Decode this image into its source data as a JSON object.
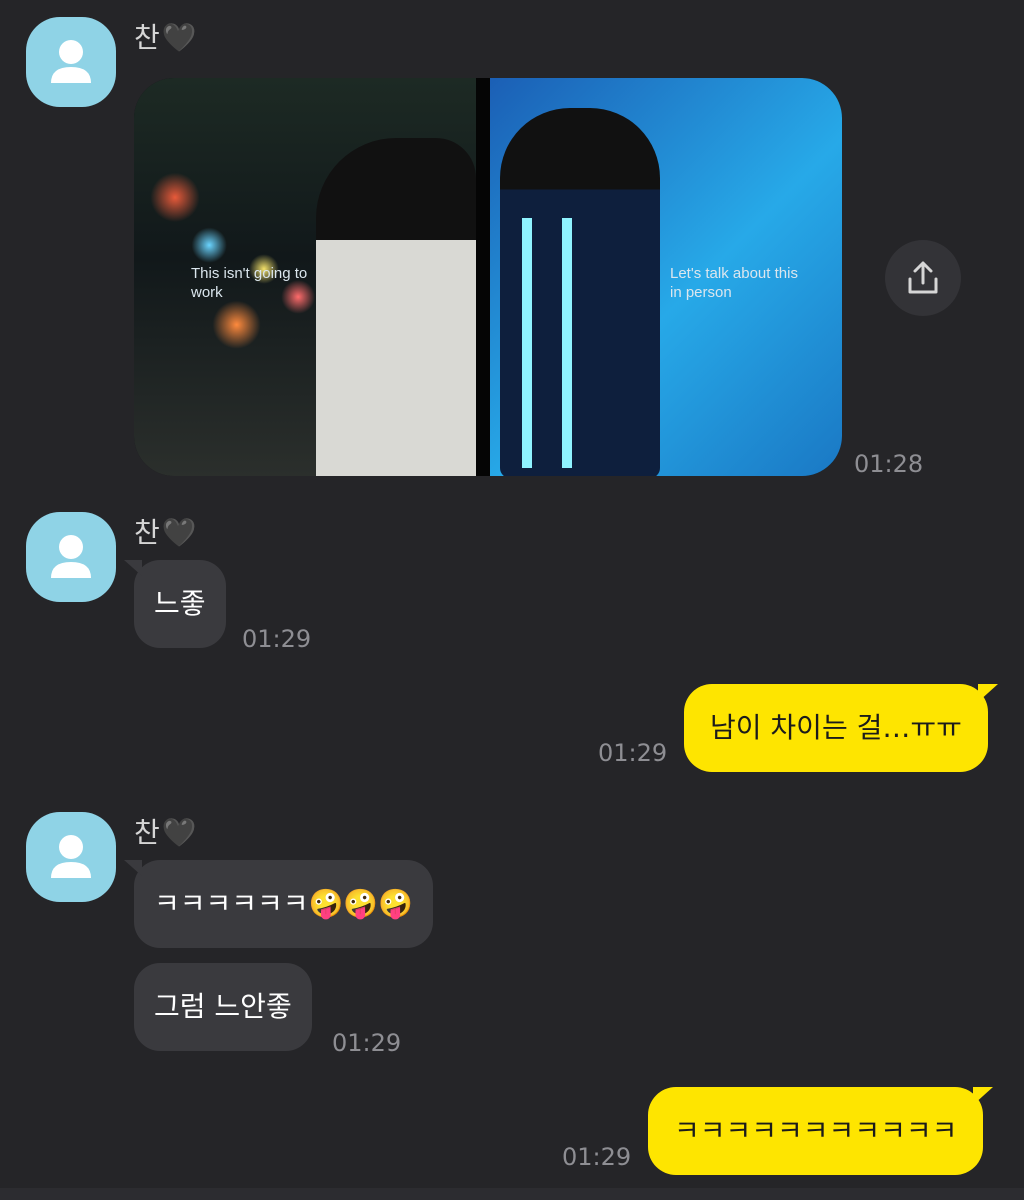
{
  "messages": {
    "group1": {
      "sender": "찬",
      "heart": "🖤",
      "image_caption_left": "This isn't going to work",
      "image_caption_right": "Let's talk about this in person",
      "time": "01:28"
    },
    "group2": {
      "sender": "찬",
      "heart": "🖤",
      "text": "느좋",
      "time": "01:29"
    },
    "out1": {
      "text": "남이 차이는 걸…ㅠㅠ",
      "time": "01:29"
    },
    "group3": {
      "sender": "찬",
      "heart": "🖤",
      "text1": "ㅋㅋㅋㅋㅋㅋ🤪🤪🤪",
      "text2": "그럼 느안좋",
      "time": "01:29"
    },
    "out2": {
      "text": "ㅋㅋㅋㅋㅋㅋㅋㅋㅋㅋㅋ",
      "time": "01:29"
    }
  },
  "icons": {
    "avatar": "person-icon",
    "share": "share-icon"
  },
  "colors": {
    "background": "#252528",
    "incoming_bubble": "#3a3a3e",
    "outgoing_bubble": "#fee500",
    "avatar": "#8fd3e6"
  }
}
